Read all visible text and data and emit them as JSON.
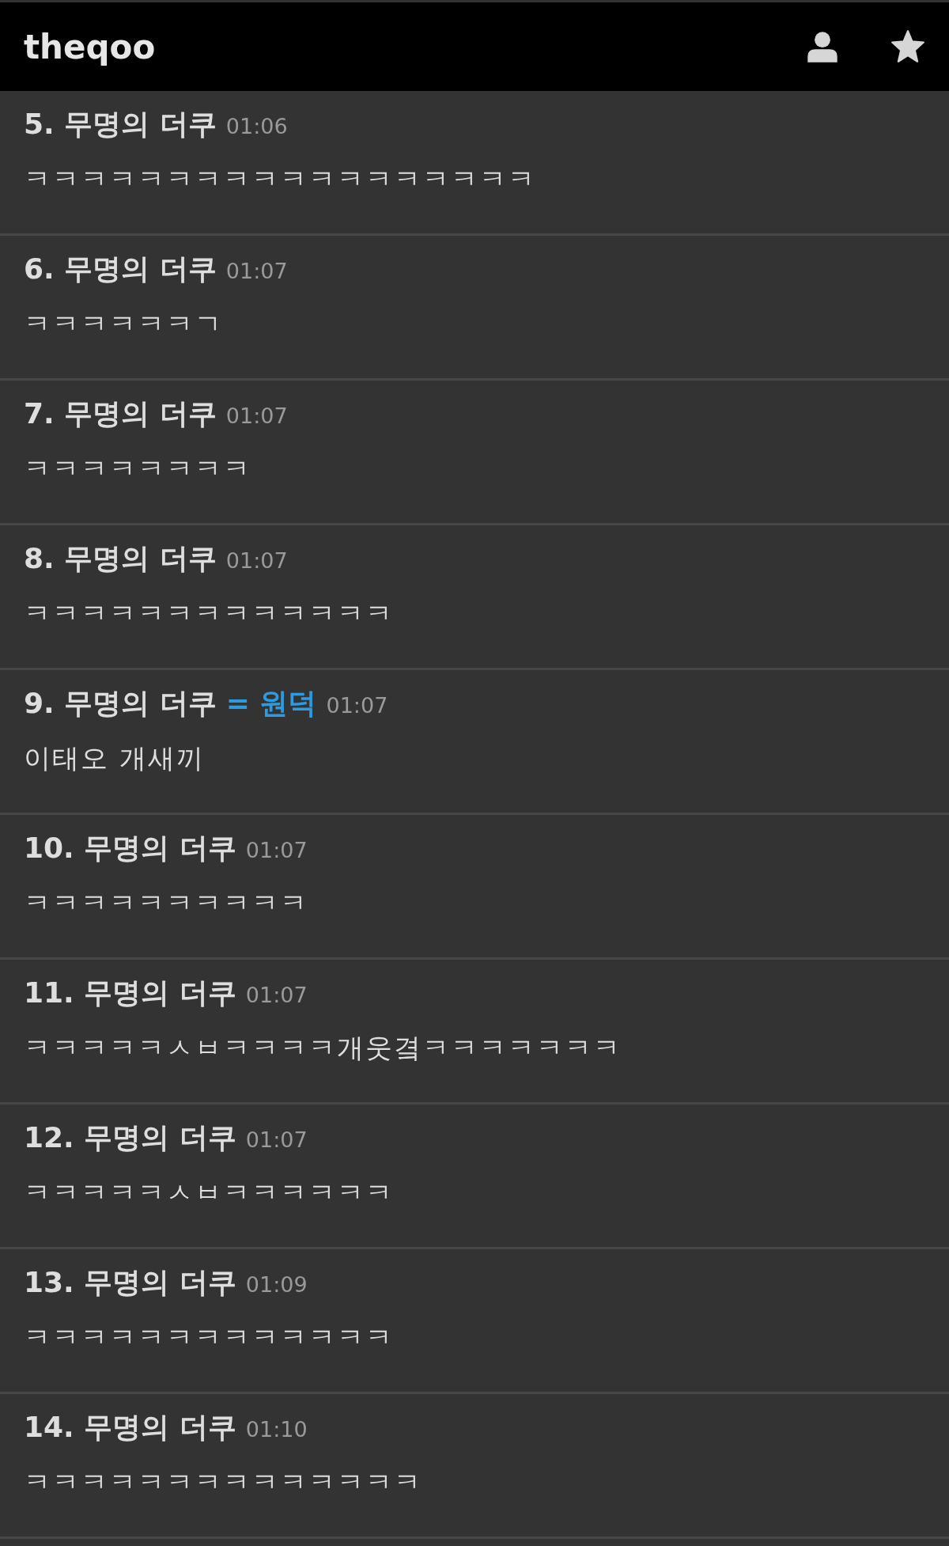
{
  "header": {
    "logo": "theqoo"
  },
  "comments": [
    {
      "title": "5. 무명의 더쿠",
      "time": "01:06",
      "body": "ㅋㅋㅋㅋㅋㅋㅋㅋㅋㅋㅋㅋㅋㅋㅋㅋㅋㅋ"
    },
    {
      "title": "6. 무명의 더쿠",
      "time": "01:07",
      "body": "ㅋㅋㅋㅋㅋㅋㄱ"
    },
    {
      "title": "7. 무명의 더쿠",
      "time": "01:07",
      "body": "ㅋㅋㅋㅋㅋㅋㅋㅋ"
    },
    {
      "title": "8. 무명의 더쿠",
      "time": "01:07",
      "body": "ㅋㅋㅋㅋㅋㅋㅋㅋㅋㅋㅋㅋㅋ"
    },
    {
      "title": "9. 무명의 더쿠",
      "tag": "= 원덕",
      "time": "01:07",
      "body": "이태오 개새끼"
    },
    {
      "title": "10. 무명의 더쿠",
      "time": "01:07",
      "body": "ㅋㅋㅋㅋㅋㅋㅋㅋㅋㅋ"
    },
    {
      "title": "11. 무명의 더쿠",
      "time": "01:07",
      "body": "ㅋㅋㅋㅋㅋㅅㅂㅋㅋㅋㅋ개웃곀ㅋㅋㅋㅋㅋㅋㅋ"
    },
    {
      "title": "12. 무명의 더쿠",
      "time": "01:07",
      "body": "ㅋㅋㅋㅋㅋㅅㅂㅋㅋㅋㅋㅋㅋ"
    },
    {
      "title": "13. 무명의 더쿠",
      "time": "01:09",
      "body": "ㅋㅋㅋㅋㅋㅋㅋㅋㅋㅋㅋㅋㅋ"
    },
    {
      "title": "14. 무명의 더쿠",
      "time": "01:10",
      "body": "ㅋㅋㅋㅋㅋㅋㅋㅋㅋㅋㅋㅋㅋㅋ"
    }
  ]
}
